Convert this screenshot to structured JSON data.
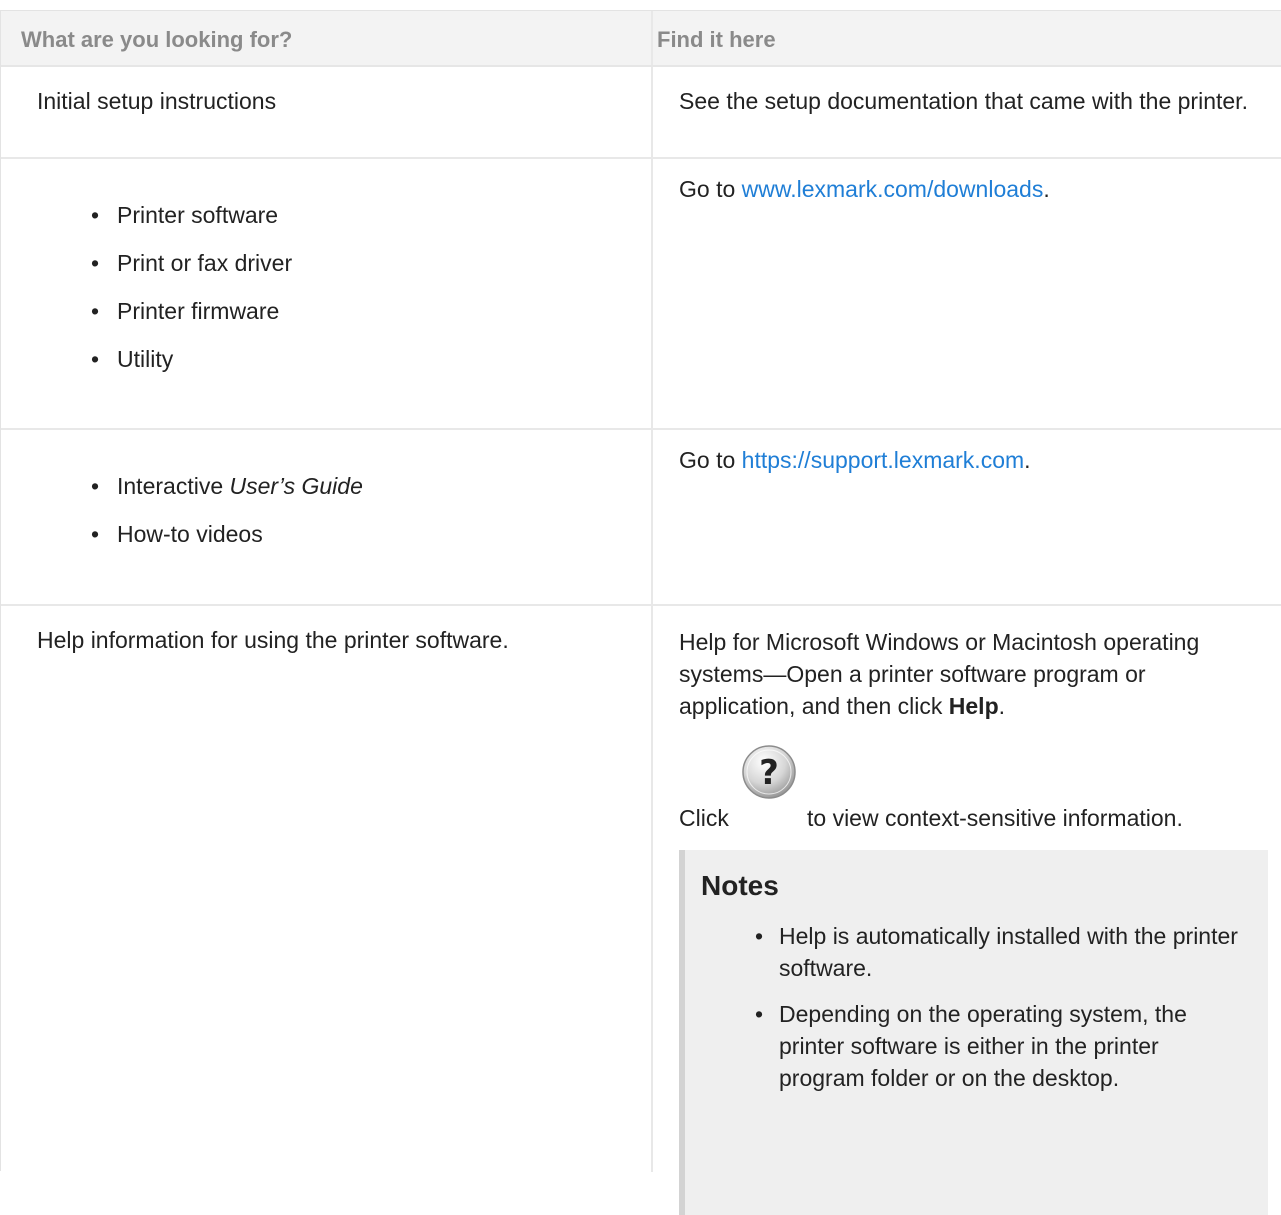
{
  "header": {
    "col1": "What are you looking for?",
    "col2": "Find it here"
  },
  "rows": [
    {
      "looking_for": "Initial setup instructions",
      "find_here": "See the setup documentation that came with the printer."
    },
    {
      "looking_for_items": [
        "Printer software",
        "Print or fax driver",
        "Printer firmware",
        "Utility"
      ],
      "find_prefix": "Go to ",
      "find_link": "www.lexmark.com/downloads",
      "find_suffix": "."
    },
    {
      "looking_for_items": [
        "Interactive",
        "How-to videos"
      ],
      "looking_for_italic": "User’s Guide",
      "find_prefix": "Go to ",
      "find_link": "https://support.lexmark.com",
      "find_suffix": "."
    },
    {
      "looking_for": "Help information for using the printer software.",
      "find_text": "Help for Microsoft Windows or Macintosh operating systems—Open a printer software program or application, and then click ",
      "find_bold": "Help",
      "find_end": ".",
      "click_label": "Click",
      "click_icon": "help-question-icon",
      "click_after": "to view context-sensitive information.",
      "notes_title": "Notes",
      "notes": [
        "Help is automatically installed with the printer software.",
        "Depending on the operating system, the printer software is either in the printer program folder or on the desktop."
      ]
    }
  ],
  "colors": {
    "link": "#1f7ed6",
    "header_bg": "#f3f3f3",
    "header_text": "#8a8a8a",
    "notes_bg": "#efefef"
  }
}
